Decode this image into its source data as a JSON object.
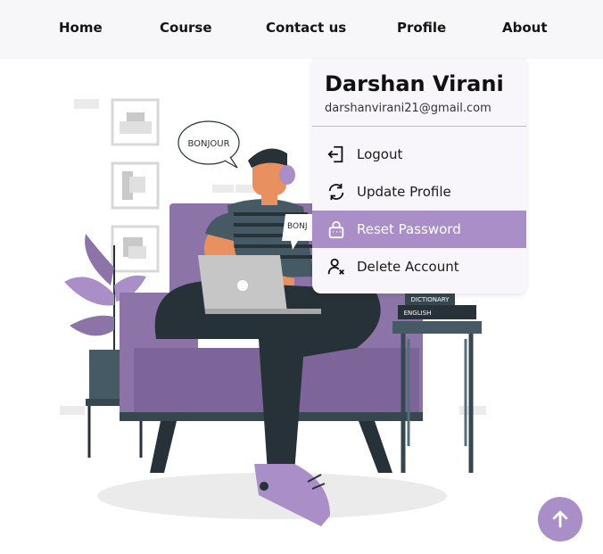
{
  "nav": {
    "items": [
      {
        "label": "Home"
      },
      {
        "label": "Course"
      },
      {
        "label": "Contact us"
      },
      {
        "label": "Profile"
      },
      {
        "label": "About"
      }
    ]
  },
  "profile_menu": {
    "name": "Darshan Virani",
    "email": "darshanvirani21@gmail.com",
    "items": [
      {
        "label": "Logout",
        "icon": "logout-icon"
      },
      {
        "label": "Update Profile",
        "icon": "refresh-icon"
      },
      {
        "label": "Reset Password",
        "icon": "lock-icon",
        "active": true
      },
      {
        "label": "Delete Account",
        "icon": "user-remove-icon"
      }
    ]
  },
  "illustration": {
    "speech_bubble": "BONJOUR",
    "laptop_bubble": "BONJ",
    "book_1": "DICTIONARY",
    "book_2": "ENGLISH"
  },
  "scroll_top": {
    "icon": "arrow-up-icon"
  },
  "colors": {
    "accent": "#a98ec8",
    "sofa": "#8d74a8",
    "dark": "#263238",
    "skin": "#e8905f"
  }
}
